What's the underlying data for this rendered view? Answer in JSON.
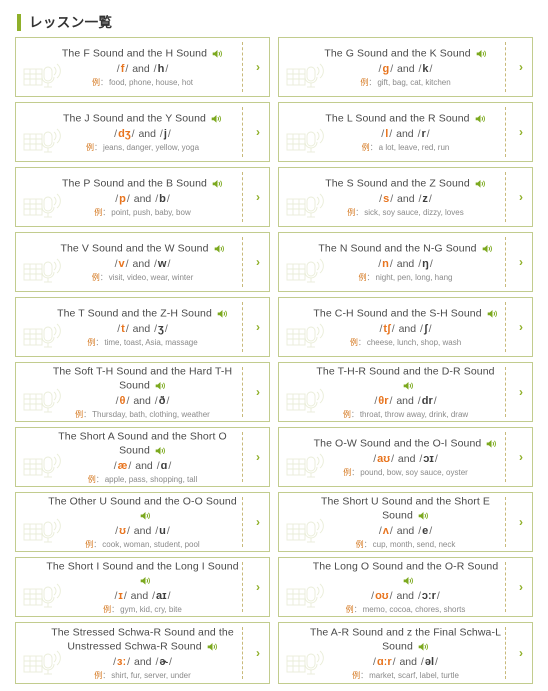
{
  "header": {
    "title": "レッスン一覧",
    "accent_color": "#8fb02a"
  },
  "card_ui": {
    "speaker_icon": "speaker-icon",
    "chevron": "›",
    "example_label": "例",
    "example_colon": "：",
    "and_text": "and",
    "slash": "/"
  },
  "lessons": [
    {
      "title": "The F Sound and the H Sound",
      "symbol_1": "f",
      "symbol_2": "h",
      "examples": "food, phone, house, hot"
    },
    {
      "title": "The G Sound and the K Sound",
      "symbol_1": "g",
      "symbol_2": "k",
      "examples": "gift, bag, cat, kitchen"
    },
    {
      "title": "The J Sound and the Y Sound",
      "symbol_1": "dʒ",
      "symbol_2": "j",
      "examples": "jeans, danger, yellow, yoga"
    },
    {
      "title": "The L Sound and the R Sound",
      "symbol_1": "l",
      "symbol_2": "r",
      "examples": "a lot, leave, red, run"
    },
    {
      "title": "The P Sound and the B Sound",
      "symbol_1": "p",
      "symbol_2": "b",
      "examples": "point, push, baby, bow"
    },
    {
      "title": "The S Sound and the Z Sound",
      "symbol_1": "s",
      "symbol_2": "z",
      "examples": "sick, soy sauce, dizzy, loves"
    },
    {
      "title": "The V Sound and the W Sound",
      "symbol_1": "v",
      "symbol_2": "w",
      "examples": "visit, video, wear, winter"
    },
    {
      "title": "The N Sound and the N-G Sound",
      "symbol_1": "n",
      "symbol_2": "ŋ",
      "examples": "night, pen, long, hang"
    },
    {
      "title": "The T Sound and the Z-H Sound",
      "symbol_1": "t",
      "symbol_2": "ʒ",
      "examples": "time, toast, Asia, massage"
    },
    {
      "title": "The C-H Sound and the S-H Sound",
      "symbol_1": "tʃ",
      "symbol_2": "ʃ",
      "examples": "cheese, lunch, shop, wash"
    },
    {
      "title": "The Soft T-H Sound and the Hard T-H Sound",
      "symbol_1": "θ",
      "symbol_2": "ð",
      "examples": "Thursday, bath, clothing, weather"
    },
    {
      "title": "The T-H-R Sound and the D-R Sound",
      "symbol_1": "θr",
      "symbol_2": "dr",
      "examples": "throat, throw away, drink, draw"
    },
    {
      "title": "The Short A Sound and the Short O Sound",
      "symbol_1": "æ",
      "symbol_2": "ɑ",
      "examples": "apple, pass, shopping, tall"
    },
    {
      "title": "The O-W Sound and the O-I Sound",
      "symbol_1": "aʊ",
      "symbol_2": "ɔɪ",
      "examples": "pound, bow, soy sauce, oyster"
    },
    {
      "title": "The Other U Sound and the O-O Sound",
      "symbol_1": "ʊ",
      "symbol_2": "u",
      "examples": "cook, woman, student, pool"
    },
    {
      "title": "The Short U Sound and the Short E Sound",
      "symbol_1": "ʌ",
      "symbol_2": "e",
      "examples": "cup, month, send, neck"
    },
    {
      "title": "The Short I Sound and the Long I Sound",
      "symbol_1": "ɪ",
      "symbol_2": "aɪ",
      "examples": "gym, kid, cry, bite"
    },
    {
      "title": "The Long O Sound and the O-R Sound",
      "symbol_1": "oʊ",
      "symbol_2": "ɔːr",
      "examples": "memo, cocoa, chores, shorts"
    },
    {
      "title": "The Stressed Schwa-R Sound and the Unstressed Schwa-R Sound",
      "symbol_1": "ɜː",
      "symbol_2": "ɚ",
      "examples": "shirt, fur, server, under"
    },
    {
      "title": "The A-R Sound and z the Final Schwa-L Sound",
      "symbol_1": "ɑːr",
      "symbol_2": "əl",
      "examples": "market, scarf, label, turtle"
    }
  ]
}
